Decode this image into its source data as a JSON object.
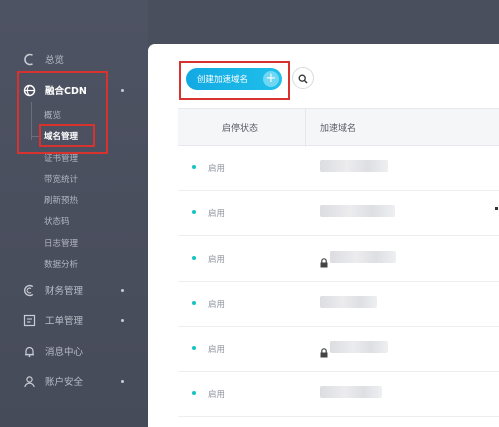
{
  "sidebar": {
    "items": [
      {
        "label": "总览",
        "icon": "overview-icon"
      },
      {
        "label": "融合CDN",
        "icon": "cdn-icon"
      },
      {
        "label": "财务管理",
        "icon": "finance-icon"
      },
      {
        "label": "工单管理",
        "icon": "ticket-icon"
      },
      {
        "label": "消息中心",
        "icon": "message-icon"
      },
      {
        "label": "账户安全",
        "icon": "account-security-icon"
      }
    ],
    "cdn_sub": [
      "概览",
      "域名管理",
      "证书管理",
      "带宽统计",
      "刷新预热",
      "状态码",
      "日志管理",
      "数据分析"
    ]
  },
  "toolbar": {
    "create_label": "创建加速域名",
    "plus": "+"
  },
  "table": {
    "headers": [
      "启停状态",
      "加速域名"
    ],
    "rows": [
      {
        "status": "启用",
        "locked": false
      },
      {
        "status": "启用",
        "locked": false
      },
      {
        "status": "启用",
        "locked": true
      },
      {
        "status": "启用",
        "locked": false
      },
      {
        "status": "启用",
        "locked": true
      },
      {
        "status": "启用",
        "locked": false
      }
    ]
  },
  "colors": {
    "accent": "#1db6e8",
    "highlight_box": "#d8322f",
    "status_green": "#19c3c1"
  }
}
